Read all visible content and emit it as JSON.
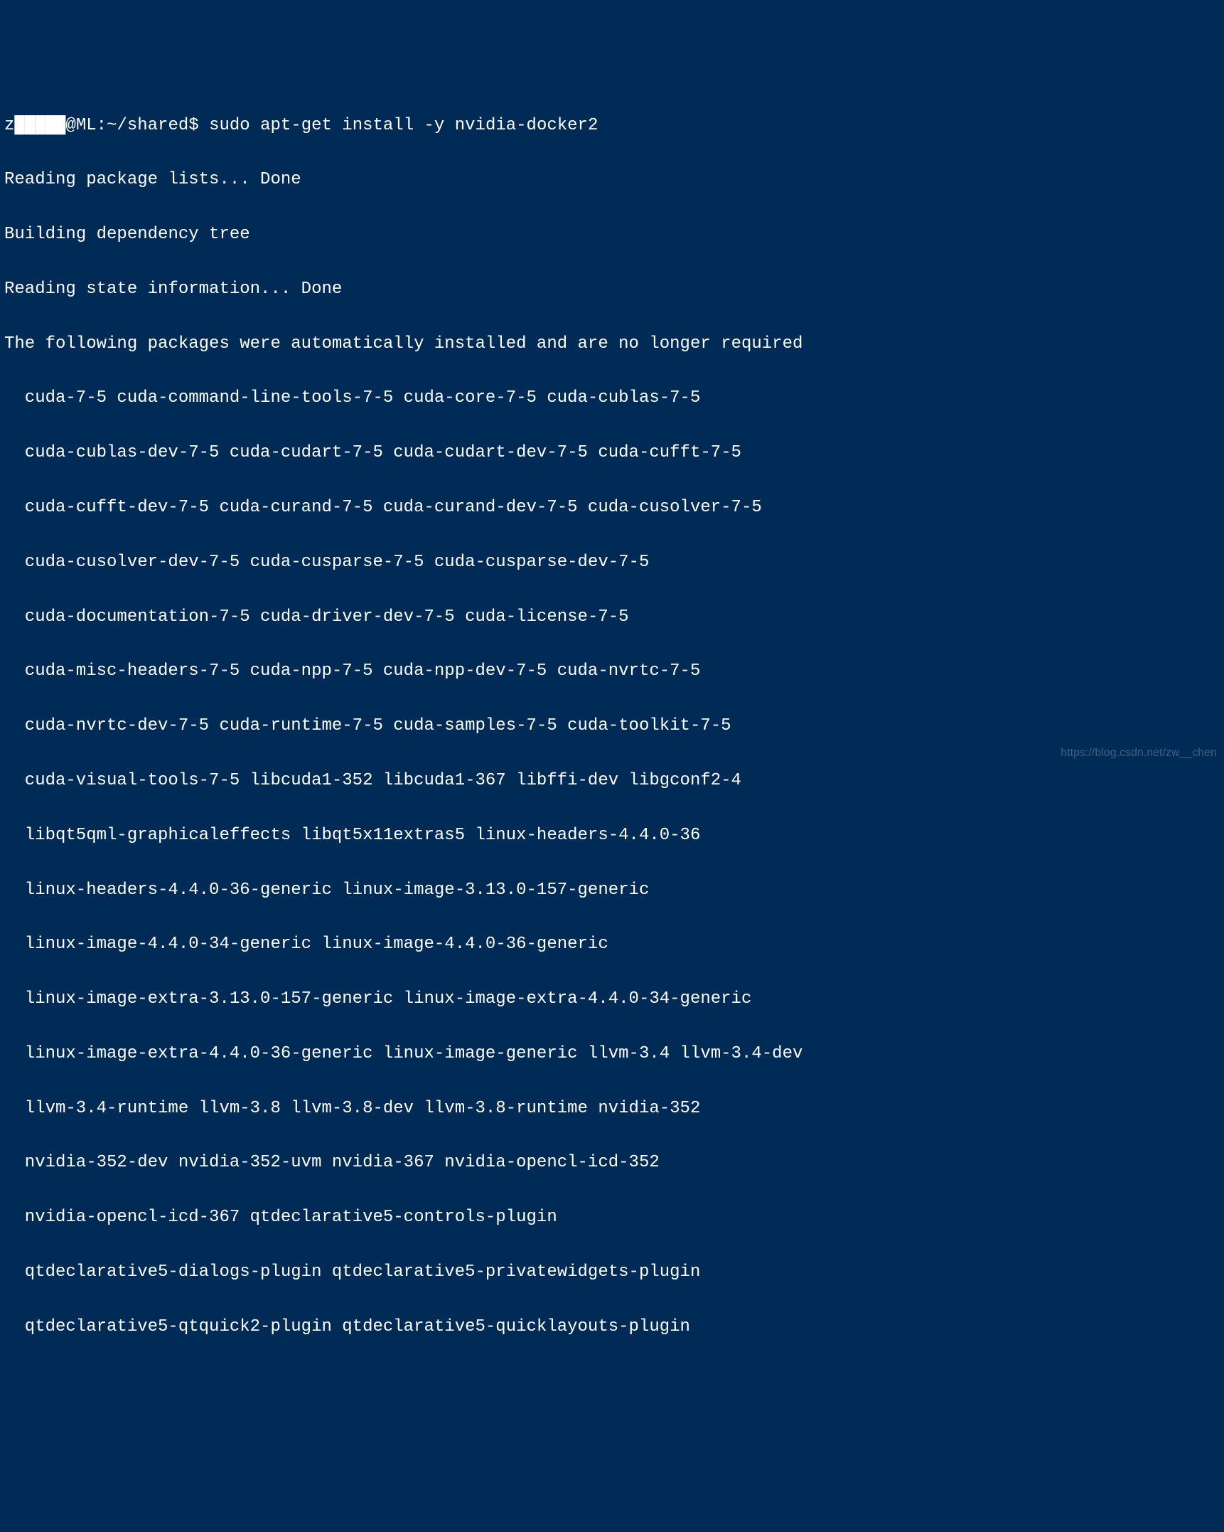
{
  "terminal": {
    "prompt": {
      "user_masked": "z█████",
      "host": "@ML",
      "path": ":~/shared$",
      "command": " sudo apt-get install -y nvidia-docker2"
    },
    "lines": [
      "Reading package lists... Done",
      "Building dependency tree",
      "Reading state information... Done",
      "The following packages were automatically installed and are no longer required"
    ],
    "packages": [
      "cuda-7-5 cuda-command-line-tools-7-5 cuda-core-7-5 cuda-cublas-7-5",
      "cuda-cublas-dev-7-5 cuda-cudart-7-5 cuda-cudart-dev-7-5 cuda-cufft-7-5",
      "cuda-cufft-dev-7-5 cuda-curand-7-5 cuda-curand-dev-7-5 cuda-cusolver-7-5",
      "cuda-cusolver-dev-7-5 cuda-cusparse-7-5 cuda-cusparse-dev-7-5",
      "cuda-documentation-7-5 cuda-driver-dev-7-5 cuda-license-7-5",
      "cuda-misc-headers-7-5 cuda-npp-7-5 cuda-npp-dev-7-5 cuda-nvrtc-7-5",
      "cuda-nvrtc-dev-7-5 cuda-runtime-7-5 cuda-samples-7-5 cuda-toolkit-7-5",
      "cuda-visual-tools-7-5 libcuda1-352 libcuda1-367 libffi-dev libgconf2-4",
      "libqt5qml-graphicaleffects libqt5x11extras5 linux-headers-4.4.0-36",
      "linux-headers-4.4.0-36-generic linux-image-3.13.0-157-generic",
      "linux-image-4.4.0-34-generic linux-image-4.4.0-36-generic",
      "linux-image-extra-3.13.0-157-generic linux-image-extra-4.4.0-34-generic",
      "linux-image-extra-4.4.0-36-generic linux-image-generic llvm-3.4 llvm-3.4-dev",
      "llvm-3.4-runtime llvm-3.8 llvm-3.8-dev llvm-3.8-runtime nvidia-352",
      "nvidia-352-dev nvidia-352-uvm nvidia-367 nvidia-opencl-icd-352",
      "nvidia-opencl-icd-367 qtdeclarative5-controls-plugin",
      "qtdeclarative5-dialogs-plugin qtdeclarative5-privatewidgets-plugin",
      "qtdeclarative5-qtquick2-plugin qtdeclarative5-quicklayouts-plugin"
    ],
    "watermark": "https://blog.csdn.net/zw__chen"
  }
}
